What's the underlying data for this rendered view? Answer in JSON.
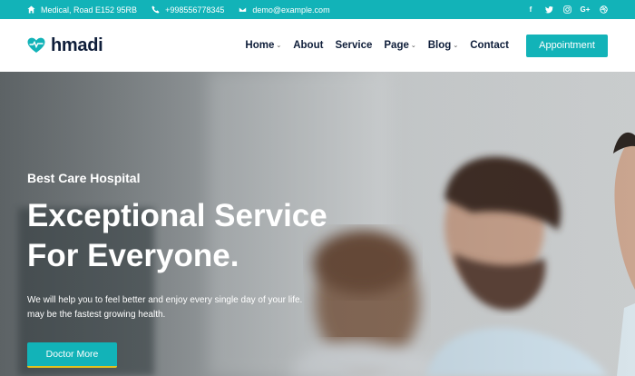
{
  "topbar": {
    "address": "Medical, Road E152 95RB",
    "phone": "+998556778345",
    "email": "demo@example.com",
    "social": [
      "facebook-icon",
      "twitter-icon",
      "instagram-icon",
      "google-plus-icon",
      "dribbble-icon"
    ],
    "google_label": "G+",
    "facebook_label": "f",
    "background": "#12b3b8"
  },
  "header": {
    "logo_text": "hmadi",
    "nav": [
      {
        "label": "Home",
        "has_dropdown": true
      },
      {
        "label": "About",
        "has_dropdown": false
      },
      {
        "label": "Service",
        "has_dropdown": false
      },
      {
        "label": "Page",
        "has_dropdown": true
      },
      {
        "label": "Blog",
        "has_dropdown": true
      },
      {
        "label": "Contact",
        "has_dropdown": false
      }
    ],
    "caret": "⌄",
    "appointment_label": "Appointment"
  },
  "hero": {
    "subtitle": "Best Care Hospital",
    "title_line1": "Exceptional Service",
    "title_line2": "For Everyone.",
    "text_line1": "We will help you to feel better and enjoy every single day of your life.",
    "text_line2": "may be the fastest growing health.",
    "button_label": "Doctor More"
  },
  "colors": {
    "accent": "#12b3b8",
    "dark": "#0f1e3a",
    "button_underline": "#e2c21f"
  }
}
